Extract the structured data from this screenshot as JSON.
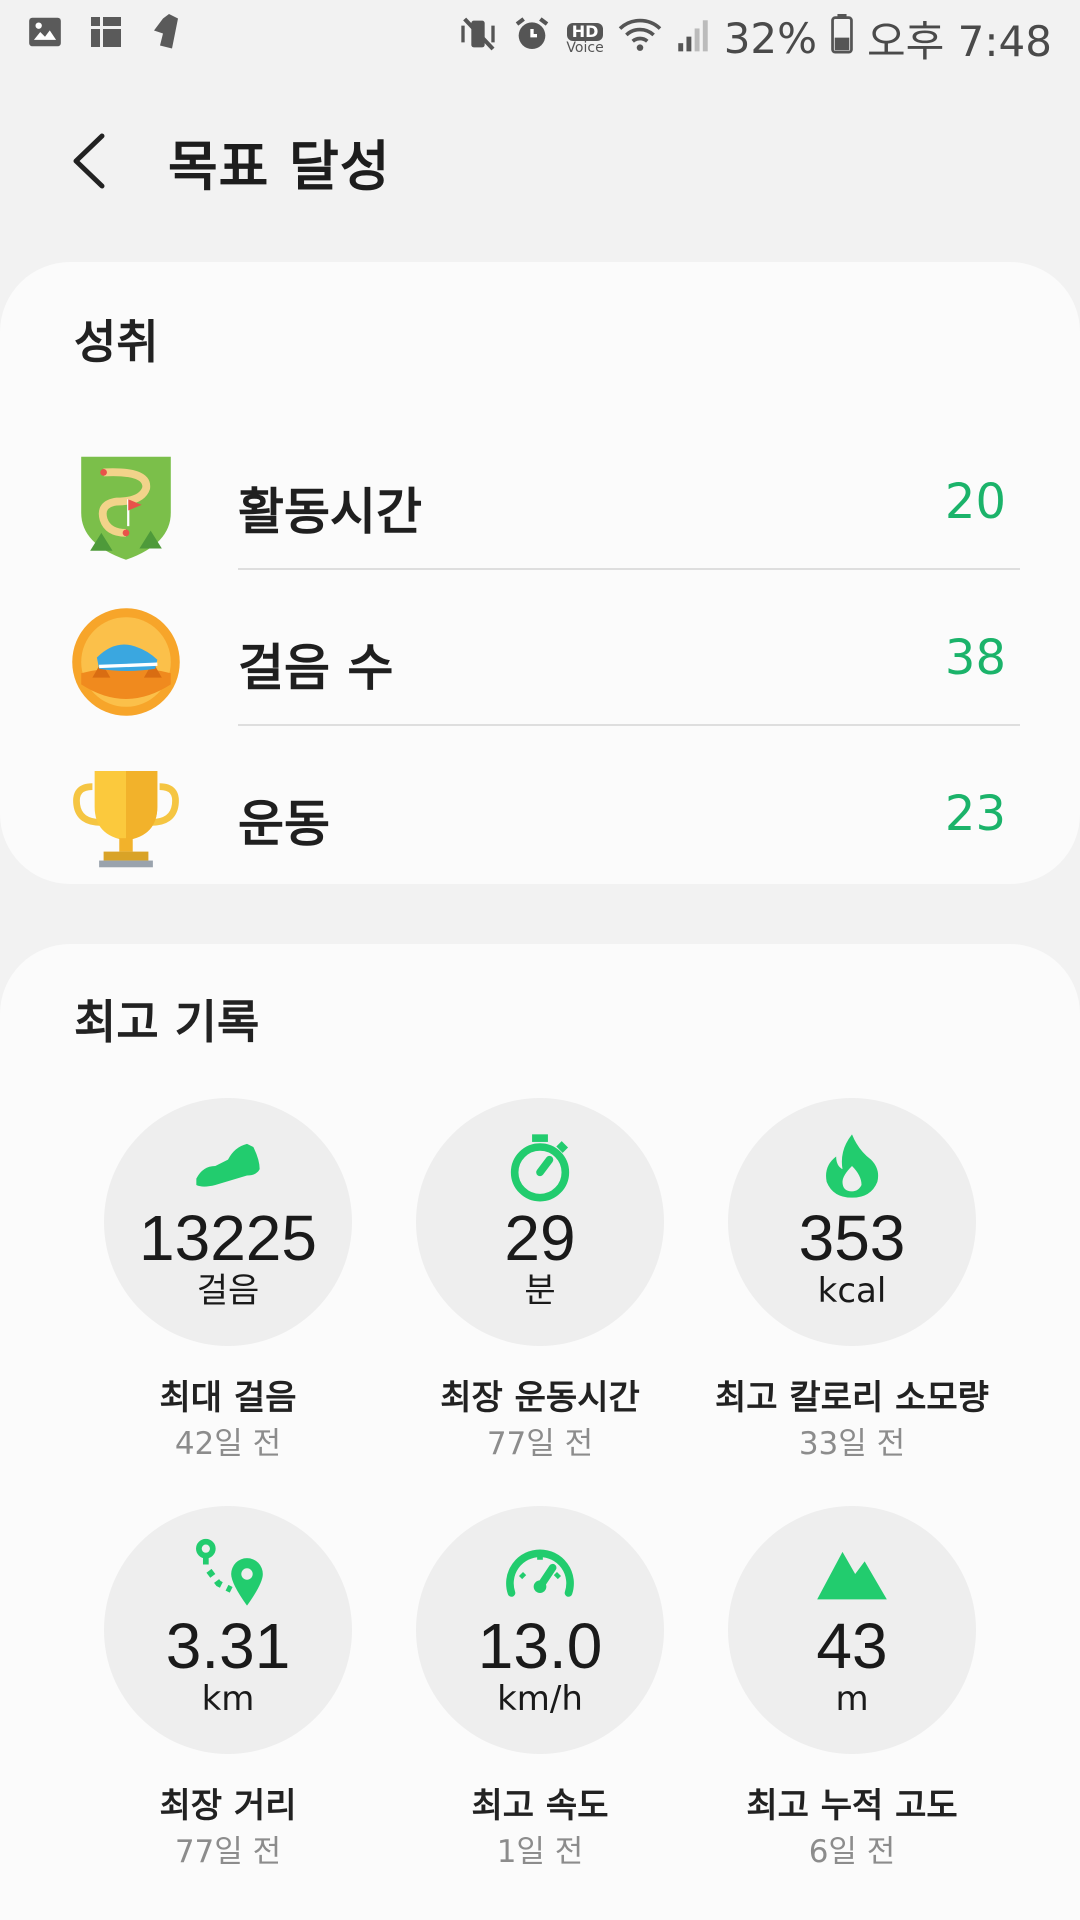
{
  "status_bar": {
    "battery": "32%",
    "time": "오후 7:48",
    "hd_voice_top": "HD",
    "hd_voice_bottom": "Voice"
  },
  "header": {
    "title": "목표 달성"
  },
  "achievements": {
    "title": "성취",
    "items": [
      {
        "label": "활동시간",
        "value": "20",
        "icon": "active-time-badge-icon"
      },
      {
        "label": "걸음 수",
        "value": "38",
        "icon": "steps-badge-icon"
      },
      {
        "label": "운동",
        "value": "23",
        "icon": "trophy-icon"
      }
    ]
  },
  "records": {
    "title": "최고 기록",
    "items": [
      {
        "value": "13225",
        "unit": "걸음",
        "label": "최대 걸음",
        "ago": "42일 전",
        "icon": "shoe-icon"
      },
      {
        "value": "29",
        "unit": "분",
        "label": "최장 운동시간",
        "ago": "77일 전",
        "icon": "stopwatch-icon"
      },
      {
        "value": "353",
        "unit": "kcal",
        "label": "최고 칼로리 소모량",
        "ago": "33일 전",
        "icon": "flame-icon"
      },
      {
        "value": "3.31",
        "unit": "km",
        "label": "최장 거리",
        "ago": "77일 전",
        "icon": "route-icon"
      },
      {
        "value": "13.0",
        "unit": "km/h",
        "label": "최고 속도",
        "ago": "1일 전",
        "icon": "speedometer-icon"
      },
      {
        "value": "43",
        "unit": "m",
        "label": "최고 누적 고도",
        "ago": "6일 전",
        "icon": "mountain-icon"
      }
    ]
  },
  "colors": {
    "accent_green": "#1bb36a",
    "icon_green": "#22cc6e"
  }
}
